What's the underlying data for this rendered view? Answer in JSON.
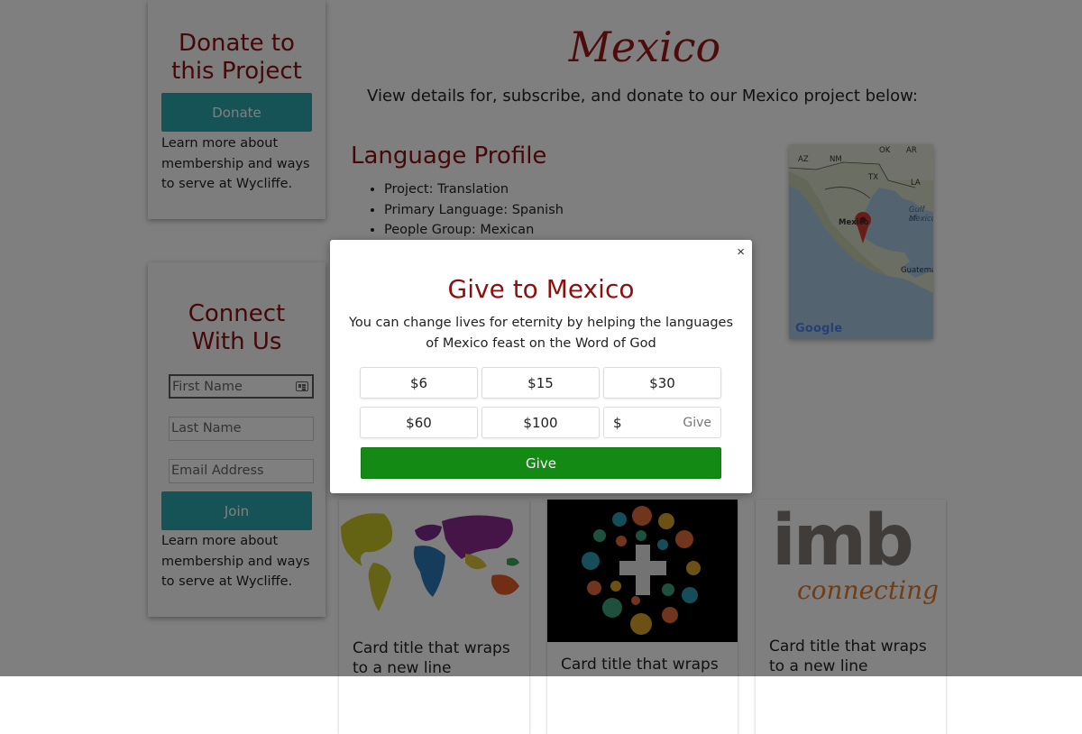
{
  "sidebar": {
    "donate_card": {
      "title": "Donate to this Project",
      "button_label": "Donate",
      "text": "Learn more about membership and ways to serve at Wycliffe."
    },
    "connect_card": {
      "title": "Connect With Us",
      "first_name_placeholder": "First Name",
      "last_name_placeholder": "Last Name",
      "email_placeholder": "Email Address",
      "button_label": "Join",
      "text": "Learn more about membership and ways to serve at Wycliffe."
    }
  },
  "main": {
    "title": "Mexico",
    "subtitle": "View details for, subscribe, and donate to our Mexico project below:",
    "language_profile": {
      "heading": "Language Profile",
      "items": [
        "Project: Translation",
        "Primary Language: Spanish",
        "People Group: Mexican"
      ]
    }
  },
  "map": {
    "labels": [
      "AZ",
      "NM",
      "OK",
      "AR",
      "TX",
      "LA",
      "Gulf of",
      "Mexico",
      "Mexico",
      "Guatema"
    ],
    "attribution": "Google"
  },
  "cards": [
    {
      "title": "Card title that wraps to a new line"
    },
    {
      "title": "Card title that wraps"
    },
    {
      "title": "Card title that wraps to a new line",
      "logo_text": "imb",
      "logo_subtext": "connecting"
    }
  ],
  "modal": {
    "title": "Give to Mexico",
    "text": "You can change lives for eternity by helping the languages of Mexico feast on the Word of God",
    "close_label": "×",
    "amounts": [
      "$6",
      "$15",
      "$30",
      "$60",
      "$100"
    ],
    "custom_prefix": "$",
    "custom_placeholder": "Give",
    "give_label": "Give"
  },
  "colors": {
    "brand_red": "#8b1010",
    "teal": "#2aa7ad",
    "give_green": "#138a13"
  }
}
